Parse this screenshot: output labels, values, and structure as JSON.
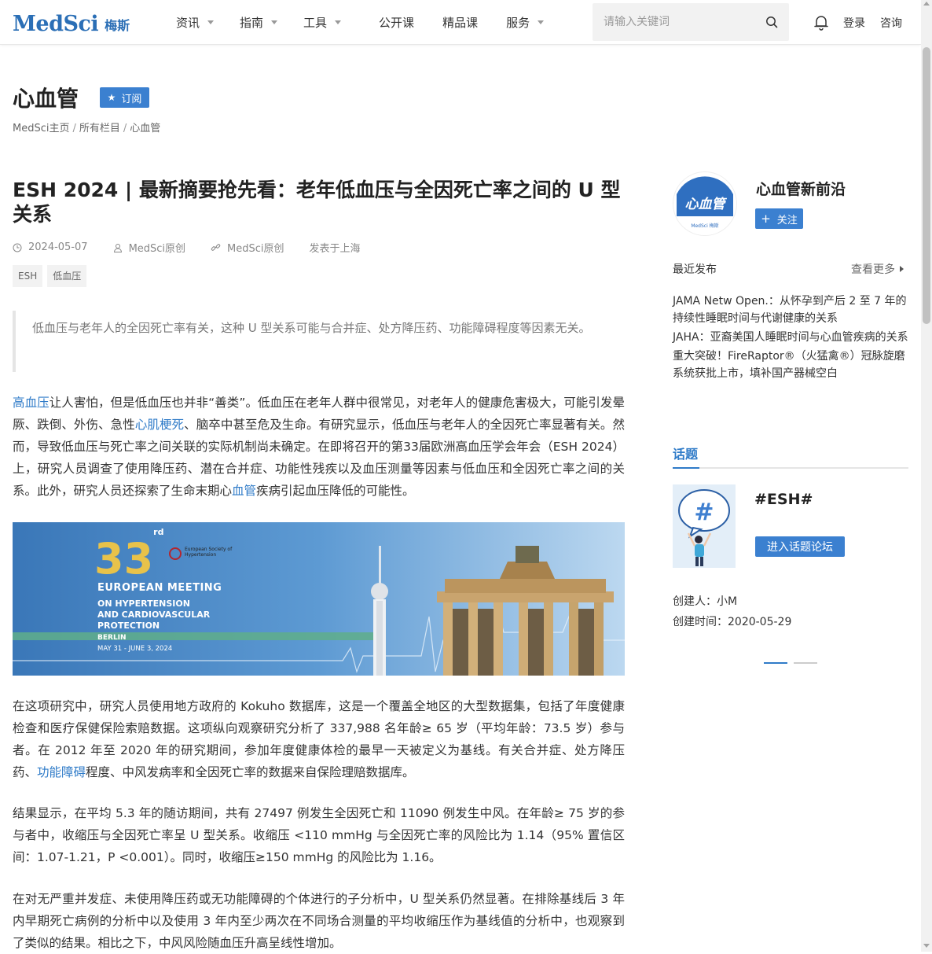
{
  "brand": {
    "logo_en": "MedSci",
    "logo_cn": "梅斯"
  },
  "nav": {
    "items": [
      {
        "label": "资讯",
        "has_dropdown": true
      },
      {
        "label": "指南",
        "has_dropdown": true
      },
      {
        "label": "工具",
        "has_dropdown": true
      },
      {
        "label": "公开课",
        "has_dropdown": false
      },
      {
        "label": "精品课",
        "has_dropdown": false
      },
      {
        "label": "服务",
        "has_dropdown": true
      }
    ],
    "search_placeholder": "请输入关键词",
    "login": "登录",
    "consult": "咨询"
  },
  "page": {
    "title": "心血管",
    "subscribe_label": "订阅",
    "breadcrumb": [
      "MedSci主页",
      "所有栏目",
      "心血管"
    ]
  },
  "article": {
    "title": "ESH 2024 | 最新摘要抢先看：老年低血压与全因死亡率之间的 U 型关系",
    "date": "2024-05-07",
    "author": "MedSci原创",
    "source": "MedSci原创",
    "location": "发表于上海",
    "tags": [
      "ESH",
      "低血压"
    ],
    "summary": "低血压与老年人的全因死亡率有关，这种 U 型关系可能与合并症、处方降压药、功能障碍程度等因素无关。",
    "p1": {
      "link1": "高血压",
      "text1": "让人害怕，但是低血压也并非“善类”。低血压在老年人群中很常见，对老年人的健康危害极大，可能引发晕厥、跌倒、外伤、急性",
      "link2": "心肌梗死",
      "text2": "、脑卒中甚至危及生命。有研究显示，低血压与老年人的全因死亡率显著有关。然而，导致低血压与死亡率之间关联的实际机制尚未确定。在即将召开的第33届欧洲高血压学会年会（ESH 2024）上，研究人员调查了使用降压药、潜在合并症、功能性残疾以及血压测量等因素与低血压和全因死亡率之间的关系。此外，研究人员还探索了生命末期心",
      "link3": "血管",
      "text3": "疾病引起血压降低的可能性。"
    },
    "banner": {
      "number": "33",
      "sup": "rd",
      "society": "European Society of Hypertension",
      "line1": "EUROPEAN MEETING",
      "line2": "ON HYPERTENSION",
      "line3": "AND CARDIOVASCULAR",
      "line4": "PROTECTION",
      "city": "BERLIN",
      "dates": "MAY 31 - JUNE 3, 2024"
    },
    "p2": {
      "text1": "在这项研究中，研究人员使用地方政府的 Kokuho 数据库，这是一个覆盖全地区的大型数据集，包括了年度健康检查和医疗保健保险索赔数据。这项纵向观察研究分析了 337,988 名年龄≥ 65 岁（平均年龄：73.5 岁）参与者。在 2012 年至 2020 年的研究期间，参加年度健康体检的最早一天被定义为基线。有关合并症、处方降压药、",
      "link1": "功能障碍",
      "text2": "程度、中风发病率和全因死亡率的数据来自保险理赔数据库。"
    },
    "p3": "结果显示，在平均 5.3 年的随访期间，共有 27497 例发生全因死亡和 11090 例发生中风。在年龄≥ 75 岁的参与者中，收缩压与全因死亡率呈 U 型关系。收缩压 <110 mmHg 与全因死亡率的风险比为 1.14（95% 置信区间：1.07-1.21，P <0.001）。同时，收缩压≥150 mmHg 的风险比为 1.16。",
    "p4": "在对无严重并发症、未使用降压药或无功能障碍的个体进行的子分析中，U 型关系仍然显著。在排除基线后 3 年内早期死亡病例的分析中以及使用 3 年内至少两次在不同场合测量的平均收缩压作为基线值的分析中，也观察到了类似的结果。相比之下，中风风险随血压升高呈线性增加。"
  },
  "sidebar": {
    "avatar_text": "心血管",
    "avatar_sub": "MedSci 梅斯",
    "channel_name": "心血管新前沿",
    "follow_label": "关注",
    "recent_heading": "最近发布",
    "more_label": "查看更多",
    "recent_items": [
      "JAMA Netw Open.：从怀孕到产后 2 至 7 年的持续性睡眠时间与代谢健康的关系",
      "JAHA：亚裔美国人睡眠时间与心血管疾病的关系",
      "重大突破！FireRaptor®（火猛禽®）冠脉旋磨系统获批上市，填补国产器械空白"
    ],
    "topic_heading": "话题",
    "topic_name": "#ESH#",
    "forum_button": "进入话题论坛",
    "creator": "创建人：小M",
    "created_time": "创建时间：2020-05-29"
  },
  "colors": {
    "accent": "#2f7bc8",
    "button": "#3b80d0",
    "logo": "#2b6fb6"
  }
}
